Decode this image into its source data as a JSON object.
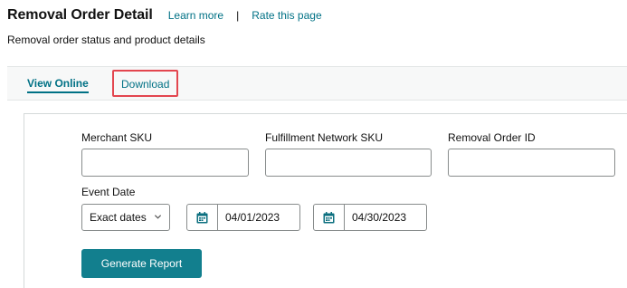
{
  "header": {
    "title": "Removal Order Detail",
    "learn_more": "Learn more",
    "separator": "|",
    "rate_page": "Rate this page",
    "subtitle": "Removal order status and product details"
  },
  "tabs": {
    "view_online": "View Online",
    "download": "Download"
  },
  "form": {
    "merchant_sku_label": "Merchant SKU",
    "merchant_sku_value": "",
    "fulfillment_sku_label": "Fulfillment Network SKU",
    "fulfillment_sku_value": "",
    "removal_order_id_label": "Removal Order ID",
    "removal_order_id_value": "",
    "event_date_label": "Event Date",
    "date_mode_selected": "Exact dates",
    "start_date": "04/01/2023",
    "end_date": "04/30/2023",
    "generate_button": "Generate Report"
  },
  "colors": {
    "link": "#007185",
    "button": "#127f8e",
    "highlight_outline": "#e3464f"
  },
  "icons": {
    "calendar": "calendar-icon",
    "dropdown": "chevron-down-icon"
  }
}
